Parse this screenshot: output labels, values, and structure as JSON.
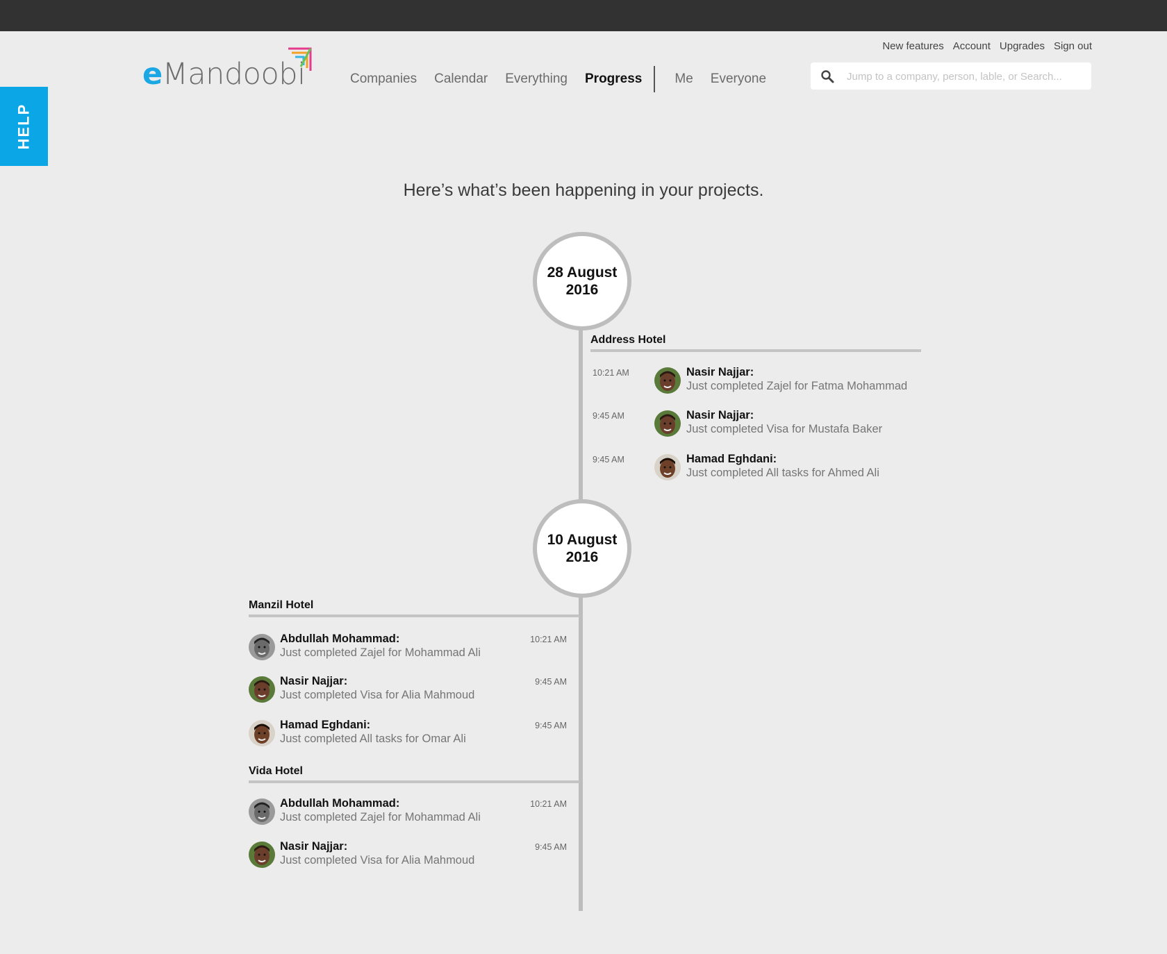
{
  "help": {
    "label": "HELP"
  },
  "logo": {
    "prefix": "e",
    "rest": "Mandoobi"
  },
  "nav": {
    "items": [
      "Companies",
      "Calendar",
      "Everything",
      "Progress"
    ],
    "active": "Progress",
    "scope_items": [
      "Me",
      "Everyone"
    ]
  },
  "top_links": [
    "New features",
    "Account",
    "Upgrades",
    "Sign out"
  ],
  "search": {
    "placeholder": "Jump to a company, person, lable, or Search..."
  },
  "headline": "Here’s what’s been happening in your projects.",
  "dates": [
    {
      "line1": "28 August",
      "line2": "2016"
    },
    {
      "line1": "10 August",
      "line2": "2016"
    }
  ],
  "groups": [
    {
      "title": "Address Hotel",
      "entries": [
        {
          "time": "10:21 AM",
          "name": "Nasir Najjar:",
          "desc": "Just completed Zajel for Fatma Mohammad",
          "avatar": "nasir"
        },
        {
          "time": "9:45 AM",
          "name": "Nasir Najjar:",
          "desc": "Just completed Visa for Mustafa Baker",
          "avatar": "nasir"
        },
        {
          "time": "9:45 AM",
          "name": "Hamad Eghdani:",
          "desc": "Just completed All tasks for Ahmed Ali",
          "avatar": "hamad"
        }
      ]
    },
    {
      "title": "Manzil Hotel",
      "entries": [
        {
          "time": "10:21 AM",
          "name": "Abdullah Mohammad:",
          "desc": "Just completed Zajel for Mohammad Ali",
          "avatar": "abdullah"
        },
        {
          "time": "9:45 AM",
          "name": "Nasir Najjar:",
          "desc": "Just completed Visa for Alia Mahmoud",
          "avatar": "nasir"
        },
        {
          "time": "9:45 AM",
          "name": "Hamad Eghdani:",
          "desc": "Just completed All tasks for Omar Ali",
          "avatar": "hamad"
        }
      ]
    },
    {
      "title": "Vida Hotel",
      "entries": [
        {
          "time": "10:21 AM",
          "name": "Abdullah Mohammad:",
          "desc": "Just completed Zajel for Mohammad Ali",
          "avatar": "abdullah"
        },
        {
          "time": "9:45 AM",
          "name": "Nasir Najjar:",
          "desc": "Just completed Visa for Alia Mahmoud",
          "avatar": "nasir"
        }
      ]
    }
  ],
  "colors": {
    "accent": "#0aa6e6",
    "topbar": "#323232",
    "background": "#ececec",
    "timeline": "#bdbdbd"
  }
}
